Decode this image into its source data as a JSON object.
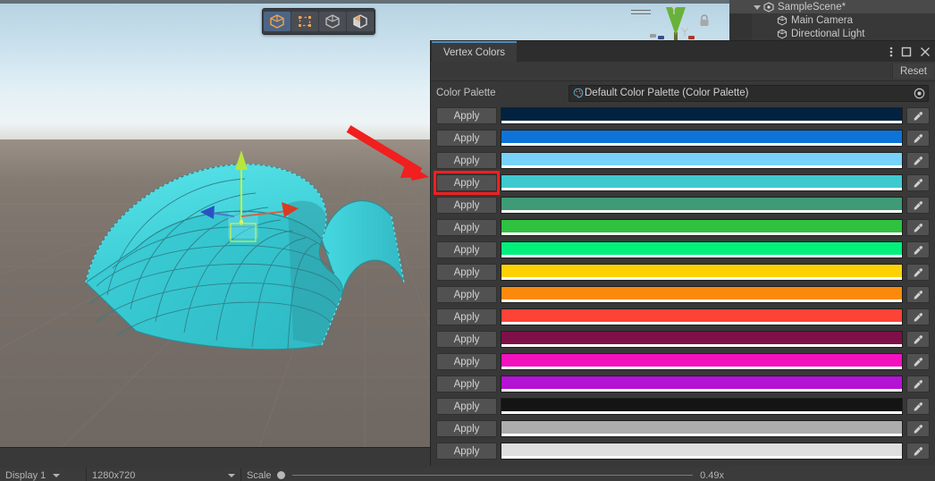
{
  "app": {
    "editor": "Unity Editor"
  },
  "scene_view": {
    "toolbar": {
      "modes": [
        {
          "name": "object-mode",
          "icon": "cube-outline-icon",
          "active": true
        },
        {
          "name": "vertex-mode",
          "icon": "vertex-points-icon",
          "active": false
        },
        {
          "name": "edge-mode",
          "icon": "cube-edges-icon",
          "active": false
        },
        {
          "name": "face-mode",
          "icon": "cube-face-icon",
          "active": false
        }
      ],
      "menu_icon": "hamburger-icon",
      "lock_icon": "lock-icon"
    },
    "gizmo": {
      "type": "move-gizmo",
      "axes": [
        "x",
        "y",
        "z"
      ],
      "x_color": "#e03b22",
      "y_color": "#b6e03a",
      "z_color": "#2d6fe0"
    },
    "mesh": {
      "name": "arch-mesh",
      "fill": "#3fd6dd",
      "wire": "#2a8e96"
    },
    "sky_top": "#b5d2e2",
    "sky_bottom": "#eef4f5",
    "ground": "#7a726b"
  },
  "game_bar": {
    "display": "Display 1",
    "resolution": "1280x720",
    "scale_label": "Scale",
    "scale_value": "0.49x"
  },
  "hierarchy": {
    "items": [
      {
        "label": "SampleScene*",
        "icon": "scene-icon",
        "depth": 0,
        "selected": true,
        "expanded": true
      },
      {
        "label": "Main Camera",
        "icon": "gameobject-icon",
        "depth": 1,
        "selected": false
      },
      {
        "label": "Directional Light",
        "icon": "gameobject-icon",
        "depth": 1,
        "selected": false
      }
    ]
  },
  "vertex_colors_window": {
    "tab_label": "Vertex Colors",
    "window_controls": [
      {
        "name": "overflow-menu",
        "icon": "kebab-menu-icon"
      },
      {
        "name": "maximize",
        "icon": "maximize-icon"
      },
      {
        "name": "close",
        "icon": "close-icon"
      }
    ],
    "reset_label": "Reset",
    "palette": {
      "label": "Color Palette",
      "value": "Default Color Palette (Color Palette)",
      "object_icon": "color-palette-asset-icon",
      "picker_icon": "object-picker-icon"
    },
    "apply_label": "Apply",
    "eyedropper_icon": "eyedropper-icon",
    "colors": [
      {
        "index": 0,
        "hex": "#012340",
        "apply": "Apply",
        "highlighted": false
      },
      {
        "index": 1,
        "hex": "#0d73d9",
        "apply": "Apply",
        "highlighted": false
      },
      {
        "index": 2,
        "hex": "#78d2f9",
        "apply": "Apply",
        "highlighted": false
      },
      {
        "index": 3,
        "hex": "#3ec9cf",
        "apply": "Apply",
        "highlighted": true
      },
      {
        "index": 4,
        "hex": "#3f9a77",
        "apply": "Apply",
        "highlighted": false
      },
      {
        "index": 5,
        "hex": "#2fc140",
        "apply": "Apply",
        "highlighted": false
      },
      {
        "index": 6,
        "hex": "#00f07a",
        "apply": "Apply",
        "highlighted": false
      },
      {
        "index": 7,
        "hex": "#fdd202",
        "apply": "Apply",
        "highlighted": false
      },
      {
        "index": 8,
        "hex": "#fb8a0c",
        "apply": "Apply",
        "highlighted": false
      },
      {
        "index": 9,
        "hex": "#fc4335",
        "apply": "Apply",
        "highlighted": false
      },
      {
        "index": 10,
        "hex": "#7e1048",
        "apply": "Apply",
        "highlighted": false
      },
      {
        "index": 11,
        "hex": "#f211bd",
        "apply": "Apply",
        "highlighted": false
      },
      {
        "index": 12,
        "hex": "#b513d4",
        "apply": "Apply",
        "highlighted": false
      },
      {
        "index": 13,
        "hex": "#141414",
        "apply": "Apply",
        "highlighted": false
      },
      {
        "index": 14,
        "hex": "#adadad",
        "apply": "Apply",
        "highlighted": false
      },
      {
        "index": 15,
        "hex": "#dedede",
        "apply": "Apply",
        "highlighted": false
      }
    ]
  },
  "annotation": {
    "arrow_color": "#f11f1f",
    "highlight_color": "#f11f1f",
    "target": "apply-button-3"
  }
}
